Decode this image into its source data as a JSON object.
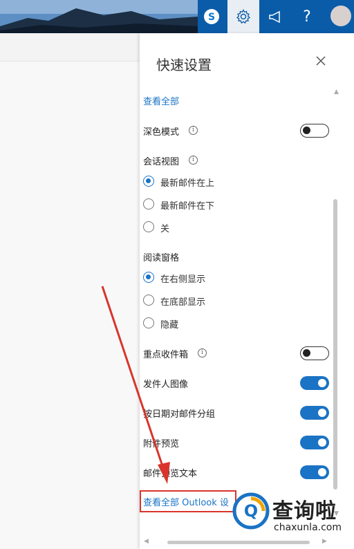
{
  "topbar": {
    "icons": [
      "skype-icon",
      "gear-icon",
      "megaphone-icon",
      "help-icon",
      "avatar"
    ],
    "help_glyph": "?"
  },
  "panel": {
    "title": "快速设置",
    "view_all": "查看全部",
    "dark_mode": {
      "label": "深色模式",
      "on": false
    },
    "conversation_view": {
      "label": "会话视图",
      "options": [
        "最新邮件在上",
        "最新邮件在下",
        "关"
      ],
      "selected": 0
    },
    "reading_pane": {
      "label": "阅读窗格",
      "options": [
        "在右侧显示",
        "在底部显示",
        "隐藏"
      ],
      "selected": 0
    },
    "focused_inbox": {
      "label": "重点收件箱",
      "on": false
    },
    "sender_image": {
      "label": "发件人图像",
      "on": true
    },
    "group_by_date": {
      "label": "按日期对邮件分组",
      "on": true
    },
    "attachment_preview": {
      "label": "附件预览",
      "on": true
    },
    "message_preview": {
      "label": "邮件预览文本",
      "on": true
    },
    "view_all_outlook": "查看全部 Outlook 设"
  },
  "watermark": {
    "cn": "查询啦",
    "en": "chaxunla.com"
  },
  "colors": {
    "accent": "#1a73c4",
    "topbar": "#0a5ca8",
    "annotation": "#d9342b"
  }
}
